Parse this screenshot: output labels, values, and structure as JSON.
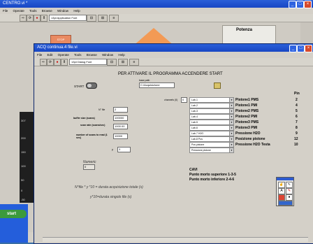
{
  "back_window": {
    "title": "CENTRO.vi *",
    "menu": [
      "File",
      "Operate",
      "Tools",
      "Browse",
      "Window",
      "Help"
    ],
    "font": "13pt Application Font",
    "stop_label": "STOP",
    "potenza_label": "Potenza"
  },
  "front_window": {
    "title": "ACQ continua.4 file.vi",
    "menu": [
      "File",
      "Edit",
      "Operate",
      "Tools",
      "Browse",
      "Window",
      "Help"
    ],
    "font": "13pt Dialog Font",
    "heading": "PER ATTIVARE IL PROGRAMMA ACCENDERE START",
    "start_label": "START",
    "base_path_label": "base path",
    "base_path_value": "C:\\Acquisizione",
    "channels_label": "channels (0)",
    "channels_value": "0",
    "nfile_label": "N° file",
    "nfile_value": "2",
    "buffer_label": "buffer size (scans)",
    "buffer_value": "100000",
    "scan_rate_label": "scan rate (scans/sec)",
    "scan_rate_value": "1000.00",
    "num_scans_label": "number of scans to read (1 sec)",
    "num_scans_value": "10000",
    "y_label": "y",
    "y_value": "3",
    "numeric_label": "Numeric",
    "numeric_value": "0",
    "formula1": "N°file * y *10 = durata acquisizione totale (s)",
    "formula2": "y*10=durata singolo file (s)",
    "pin_header": "Pin",
    "channel_items": [
      "Pistone1 PMS",
      "Pistone1 PMI",
      "Pistone2 PMS",
      "Pistone2 PMI",
      "Pistone3 PMS",
      "Pistone3 PMI",
      "Pressione H2O",
      "Posizione pistone",
      "Pressione H2O Testa"
    ],
    "pins": [
      "2",
      "4",
      "5",
      "6",
      "7",
      "8",
      "9",
      "12",
      "10"
    ],
    "dropdown_items": [
      "Lab-1",
      "Lab-2",
      "Lab-3",
      "Lab-4",
      "Lab-5",
      "Lab-6",
      "Lab-7 H2O",
      "Lab-8 Pos",
      "Pos pistone",
      "Pressione pistone"
    ],
    "cavi_title": "CAVI",
    "cavi_line1": "Punto morto superiore 1-3-5",
    "cavi_line2": "Punto morto inferiore 2-4-6"
  },
  "taskbar": {
    "start_label": "start"
  },
  "axis_labels": [
    "307",
    "200",
    "150",
    "100",
    "50",
    "0",
    "-50"
  ]
}
